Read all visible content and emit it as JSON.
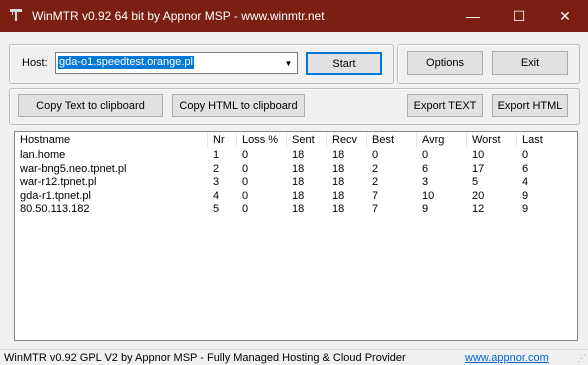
{
  "window": {
    "title": "WinMTR v0.92 64 bit by Appnor MSP - www.winmtr.net",
    "minimize_glyph": "—",
    "maximize_glyph": "☐",
    "close_glyph": "✕",
    "titlebar_color": "#7a1f12"
  },
  "host": {
    "label": "Host:",
    "value": "gda-o1.speedtest.orange.pl",
    "dropdown_glyph": "▼",
    "start_label": "Start"
  },
  "actions": {
    "options_label": "Options",
    "exit_label": "Exit",
    "copy_text_label": "Copy Text to clipboard",
    "copy_html_label": "Copy HTML to clipboard",
    "export_text_label": "Export TEXT",
    "export_html_label": "Export HTML"
  },
  "table": {
    "columns": [
      "Hostname",
      "Nr",
      "Loss %",
      "Sent",
      "Recv",
      "Best",
      "Avrg",
      "Worst",
      "Last"
    ],
    "rows": [
      [
        "lan.home",
        "1",
        "0",
        "18",
        "18",
        "0",
        "0",
        "10",
        "0"
      ],
      [
        "war-bng5.neo.tpnet.pl",
        "2",
        "0",
        "18",
        "18",
        "2",
        "6",
        "17",
        "6"
      ],
      [
        "war-r12.tpnet.pl",
        "3",
        "0",
        "18",
        "18",
        "2",
        "3",
        "5",
        "4"
      ],
      [
        "gda-r1.tpnet.pl",
        "4",
        "0",
        "18",
        "18",
        "7",
        "10",
        "20",
        "9"
      ],
      [
        "80.50.113.182",
        "5",
        "0",
        "18",
        "18",
        "7",
        "9",
        "12",
        "9"
      ]
    ]
  },
  "status": {
    "text": "WinMTR v0.92 GPL V2 by Appnor MSP - Fully Managed Hosting & Cloud Provider",
    "link": "www.appnor.com"
  }
}
